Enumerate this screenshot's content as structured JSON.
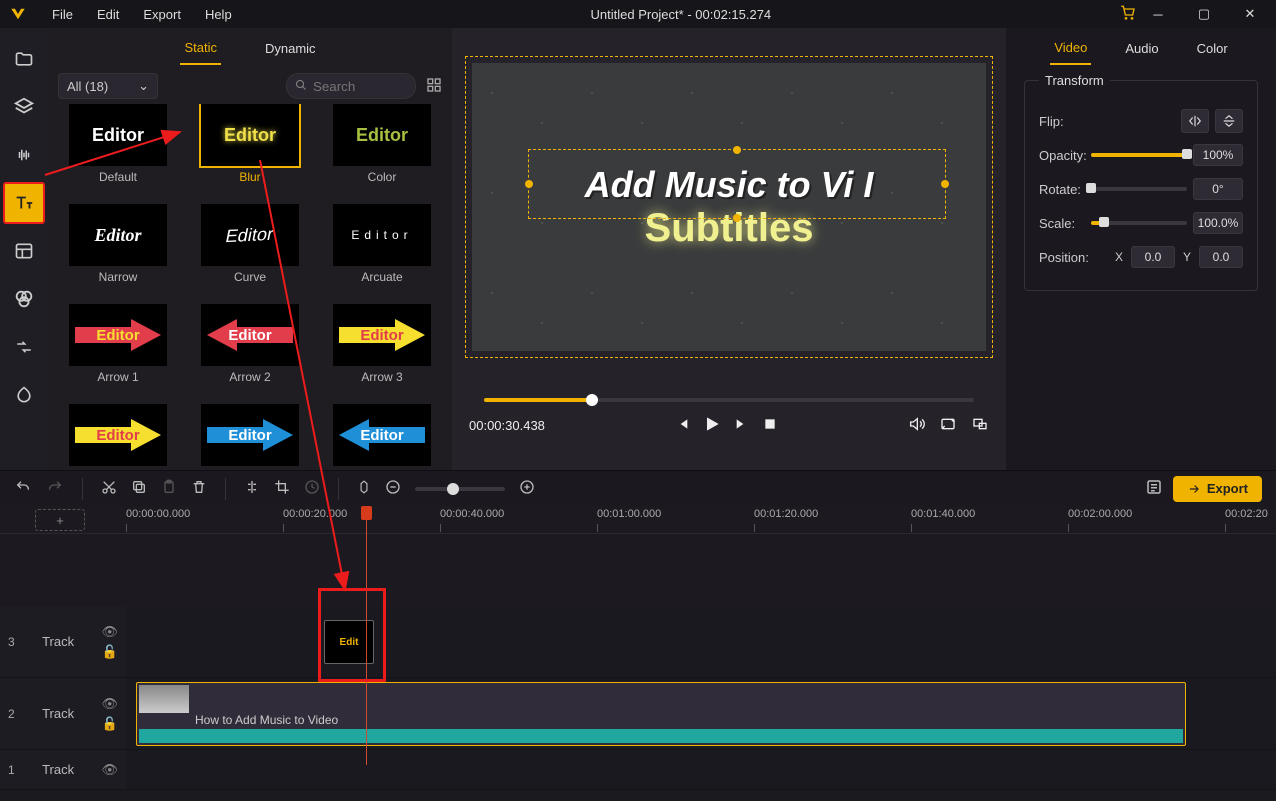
{
  "title": "Untitled Project* - 00:02:15.274",
  "menu": {
    "file": "File",
    "edit": "Edit",
    "export": "Export",
    "help": "Help"
  },
  "panel_tabs": {
    "static": "Static",
    "dynamic": "Dynamic"
  },
  "filter_label": "All (18)",
  "search_placeholder": "Search",
  "assets": [
    {
      "name": "Default"
    },
    {
      "name": "Blur"
    },
    {
      "name": "Color"
    },
    {
      "name": "Narrow"
    },
    {
      "name": "Curve"
    },
    {
      "name": "Arcuate"
    },
    {
      "name": "Arrow 1"
    },
    {
      "name": "Arrow 2"
    },
    {
      "name": "Arrow 3"
    },
    {
      "name": ""
    },
    {
      "name": ""
    },
    {
      "name": ""
    }
  ],
  "editor_word": "Editor",
  "preview": {
    "heading": "Add Music to Vi I",
    "subheading": "Subtitles",
    "current_time": "00:00:30.438"
  },
  "props_tabs": {
    "video": "Video",
    "audio": "Audio",
    "color": "Color"
  },
  "transform": {
    "section": "Transform",
    "flip": "Flip:",
    "opacity_lbl": "Opacity:",
    "opacity": "100%",
    "rotate_lbl": "Rotate:",
    "rotate": "0°",
    "scale_lbl": "Scale:",
    "scale": "100.0%",
    "position_lbl": "Position:",
    "x_lbl": "X",
    "x": "0.0",
    "y_lbl": "Y",
    "y": "0.0"
  },
  "export_label": "Export",
  "ruler": [
    "00:00:00.000",
    "00:00:20.000",
    "00:00:40.000",
    "00:01:00.000",
    "00:01:20.000",
    "00:01:40.000",
    "00:02:00.000",
    "00:02:20"
  ],
  "tracks": {
    "t3": "Track",
    "t2": "Track",
    "t1": "Track",
    "n3": "3",
    "n2": "2",
    "n1": "1"
  },
  "clip": {
    "video_title": "How to Add Music to Video",
    "text_thumb": "Edit"
  }
}
